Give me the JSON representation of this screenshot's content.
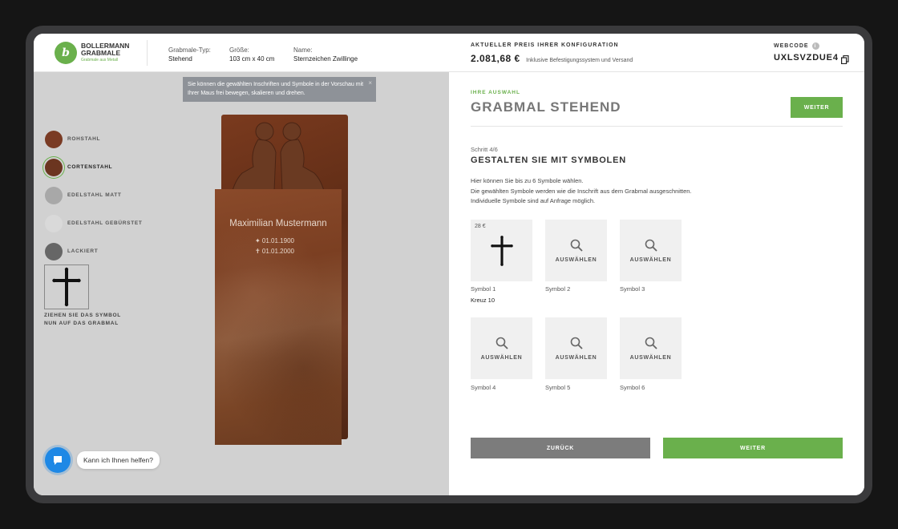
{
  "brand": {
    "mark": "b",
    "line1": "BOLLERMANN",
    "line2": "GRABMALE",
    "tagline": "Grabmale aus Metall"
  },
  "header": {
    "type_label": "Grabmale-Typ:",
    "type_value": "Stehend",
    "size_label": "Größe:",
    "size_value": "103 cm x 40 cm",
    "name_label": "Name:",
    "name_value": "Sternzeichen Zwillinge",
    "price_label": "AKTUELLER PREIS IHRER KONFIGURATION",
    "price_value": "2.081,68 €",
    "price_note": "Inklusive Befestigungssystem und Versand",
    "webcode_label": "WEBCODE",
    "webcode_value": "UXLSVZDUE4"
  },
  "preview": {
    "tooltip": "Sie können die gewählten Inschriften und Symbole in der Vorschau mit Ihrer Maus frei bewegen, skalieren und drehen.",
    "tooltip_close": "×",
    "materials": [
      {
        "label": "ROHSTAHL",
        "color": "#7a3b24"
      },
      {
        "label": "CORTENSTAHL",
        "color": "#6b3520"
      },
      {
        "label": "EDELSTAHL MATT",
        "color": "#a8a8a8"
      },
      {
        "label": "EDELSTAHL GEBÜRSTET",
        "color": "#d9d9d9"
      },
      {
        "label": "LACKIERT",
        "color": "#666666"
      }
    ],
    "active_material": "CORTENSTAHL",
    "drag_hint": "ZIEHEN SIE DAS SYMBOL\nNUN AUF DAS GRABMAL",
    "engraving_name": "Maximilian Mustermann",
    "birth": "✦ 01.01.1900",
    "death": "✝ 01.01.2000"
  },
  "chat": {
    "bubble": "Kann ich Ihnen helfen?"
  },
  "config": {
    "eyebrow": "IHRE AUSWAHL",
    "title": "GRABMAL STEHEND",
    "next_small": "WEITER",
    "step": "Schritt 4/6",
    "step_title": "GESTALTEN SIE MIT SYMBOLEN",
    "desc1": "Hier können Sie bis zu 6 Symbole wählen.",
    "desc2": "Die gewählten Symbole werden wie die Inschrift aus dem Grabmal ausgeschnitten.",
    "desc3": "Individuelle Symbole sind auf Anfrage möglich.",
    "slots": [
      {
        "caption": "Symbol 1",
        "price": "28 €",
        "selected": "Kreuz 10"
      },
      {
        "caption": "Symbol 2",
        "action": "AUSWÄHLEN"
      },
      {
        "caption": "Symbol 3",
        "action": "AUSWÄHLEN"
      },
      {
        "caption": "Symbol 4",
        "action": "AUSWÄHLEN"
      },
      {
        "caption": "Symbol 5",
        "action": "AUSWÄHLEN"
      },
      {
        "caption": "Symbol 6",
        "action": "AUSWÄHLEN"
      }
    ],
    "back": "ZURÜCK",
    "next": "WEITER"
  }
}
